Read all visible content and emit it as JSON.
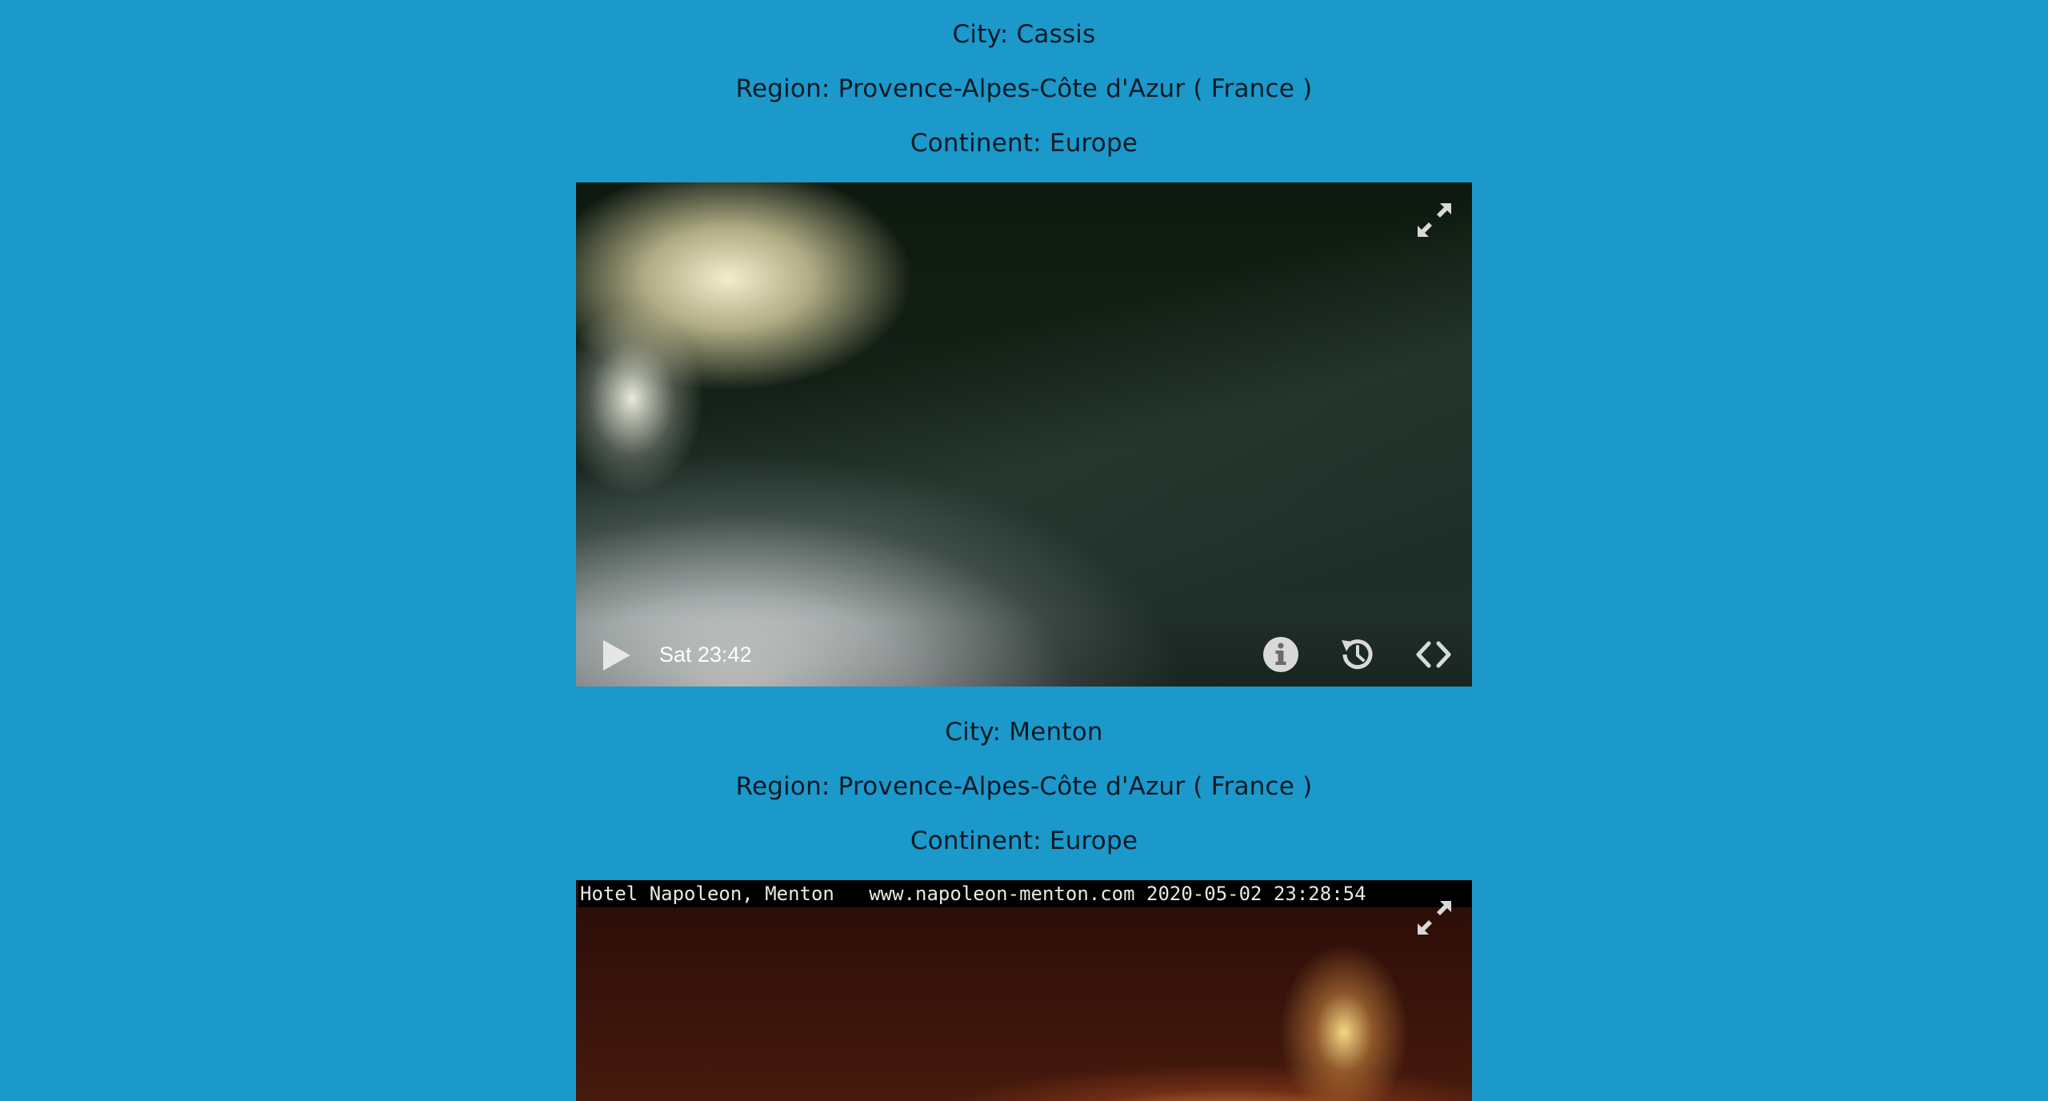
{
  "cameras": [
    {
      "city_label": "City: Cassis",
      "region_label": "Region: Provence-Alpes-Côte d'Azur ( France )",
      "continent_label": "Continent: Europe",
      "player": {
        "timestamp": "Sat 23:42",
        "icons": [
          "fullscreen-icon",
          "play-icon",
          "info-icon",
          "history-icon",
          "embed-code-icon"
        ]
      }
    },
    {
      "city_label": "City: Menton",
      "region_label": "Region: Provence-Alpes-Côte d'Azur ( France )",
      "continent_label": "Continent: Europe",
      "player": {
        "overlay_text": "Hotel Napoleon, Menton   www.napoleon-menton.com 2020-05-02 23:28:54",
        "icons": [
          "fullscreen-icon"
        ]
      }
    }
  ],
  "colors": {
    "page_background": "#1b99cb",
    "icon_color": "#d9d9d9"
  }
}
